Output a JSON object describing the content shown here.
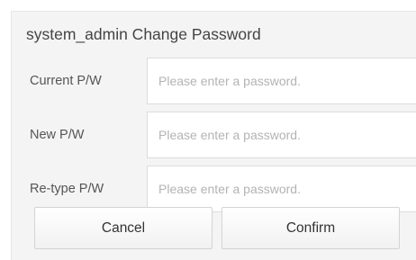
{
  "dialog": {
    "title": "system_admin Change Password"
  },
  "fields": [
    {
      "label": "Current P/W",
      "value": "",
      "placeholder": "Please enter a password."
    },
    {
      "label": "New P/W",
      "value": "",
      "placeholder": "Please enter a password."
    },
    {
      "label": "Re-type P/W",
      "value": "",
      "placeholder": "Please enter a password."
    }
  ],
  "buttons": {
    "cancel_label": "Cancel",
    "confirm_label": "Confirm"
  }
}
